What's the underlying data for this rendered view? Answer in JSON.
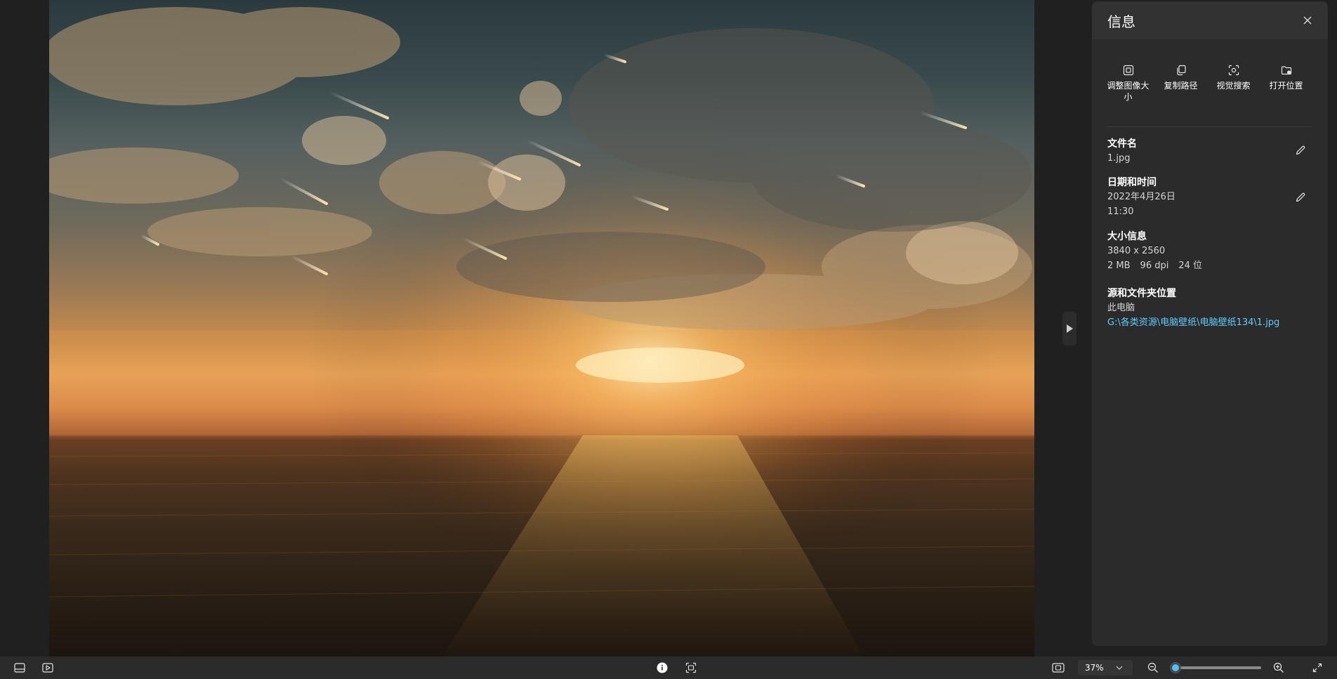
{
  "panel": {
    "title": "信息",
    "close_icon": "close-icon",
    "actions": [
      {
        "label": "调整图像大小",
        "icon": "resize-image-icon"
      },
      {
        "label": "复制路径",
        "icon": "copy-icon"
      },
      {
        "label": "视觉搜索",
        "icon": "visual-search-icon"
      },
      {
        "label": "打开位置",
        "icon": "folder-open-icon"
      }
    ],
    "file_name": {
      "title": "文件名",
      "value": "1.jpg"
    },
    "date_time": {
      "title": "日期和时间",
      "date": "2022年4月26日",
      "time": "11:30"
    },
    "size_info": {
      "title": "大小信息",
      "dimensions": "3840 x 2560",
      "file_size": "2 MB",
      "dpi": "96 dpi",
      "bit_depth": "24 位"
    },
    "source": {
      "title": "源和文件夹位置",
      "location": "此电脑",
      "path": "G:\\各类资源\\电脑壁纸\\电脑壁纸134\\1.jpg"
    }
  },
  "bottom_bar": {
    "zoom_value": "37%",
    "zoom_level": 0.05
  },
  "colors": {
    "accent": "#4cc2ff",
    "link": "#60cdff",
    "background": "#202020",
    "panel": "#2b2b2b"
  }
}
